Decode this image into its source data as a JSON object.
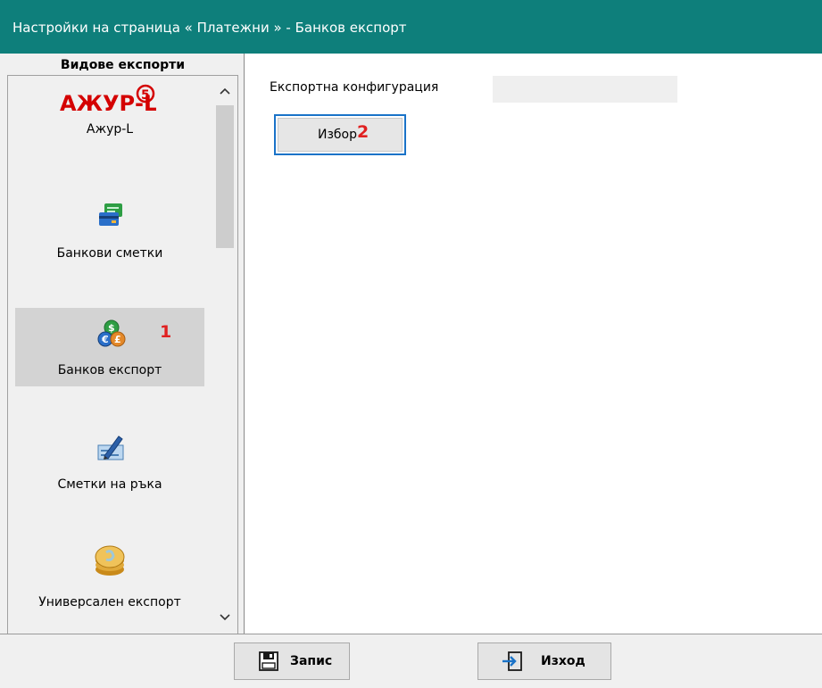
{
  "window": {
    "title": "Настройки на страница « Платежни » - Банков експорт"
  },
  "sidebar": {
    "header": "Видове експорти",
    "items": [
      {
        "label": "Ажур-L",
        "icon": "azhur-l-logo",
        "logo_text": "АЖУР-L",
        "logo_version": "5"
      },
      {
        "label": "Банкови сметки",
        "icon": "bank-card-icon"
      },
      {
        "label": "Банков експорт",
        "icon": "currency-coins-icon",
        "selected": true
      },
      {
        "label": "Сметки на ръка",
        "icon": "handwritten-check-icon"
      },
      {
        "label": "Универсален експорт",
        "icon": "gold-coins-icon"
      }
    ],
    "scroll_up_icon": "chevron-up-icon",
    "scroll_down_icon": "chevron-down-icon"
  },
  "main": {
    "config_label": "Експортна конфигурация",
    "config_value": "",
    "choose_button": "Избор"
  },
  "annotations": {
    "marker_1": "1",
    "marker_2": "2"
  },
  "footer": {
    "save_label": "Запис",
    "save_icon": "save-icon",
    "exit_label": "Изход",
    "exit_icon": "exit-icon"
  },
  "colors": {
    "titlebar": "#0e7f7b",
    "selection": "#d3d3d3",
    "focus_border": "#1a73c8",
    "marker": "#e02020",
    "logo_red": "#d40000"
  }
}
